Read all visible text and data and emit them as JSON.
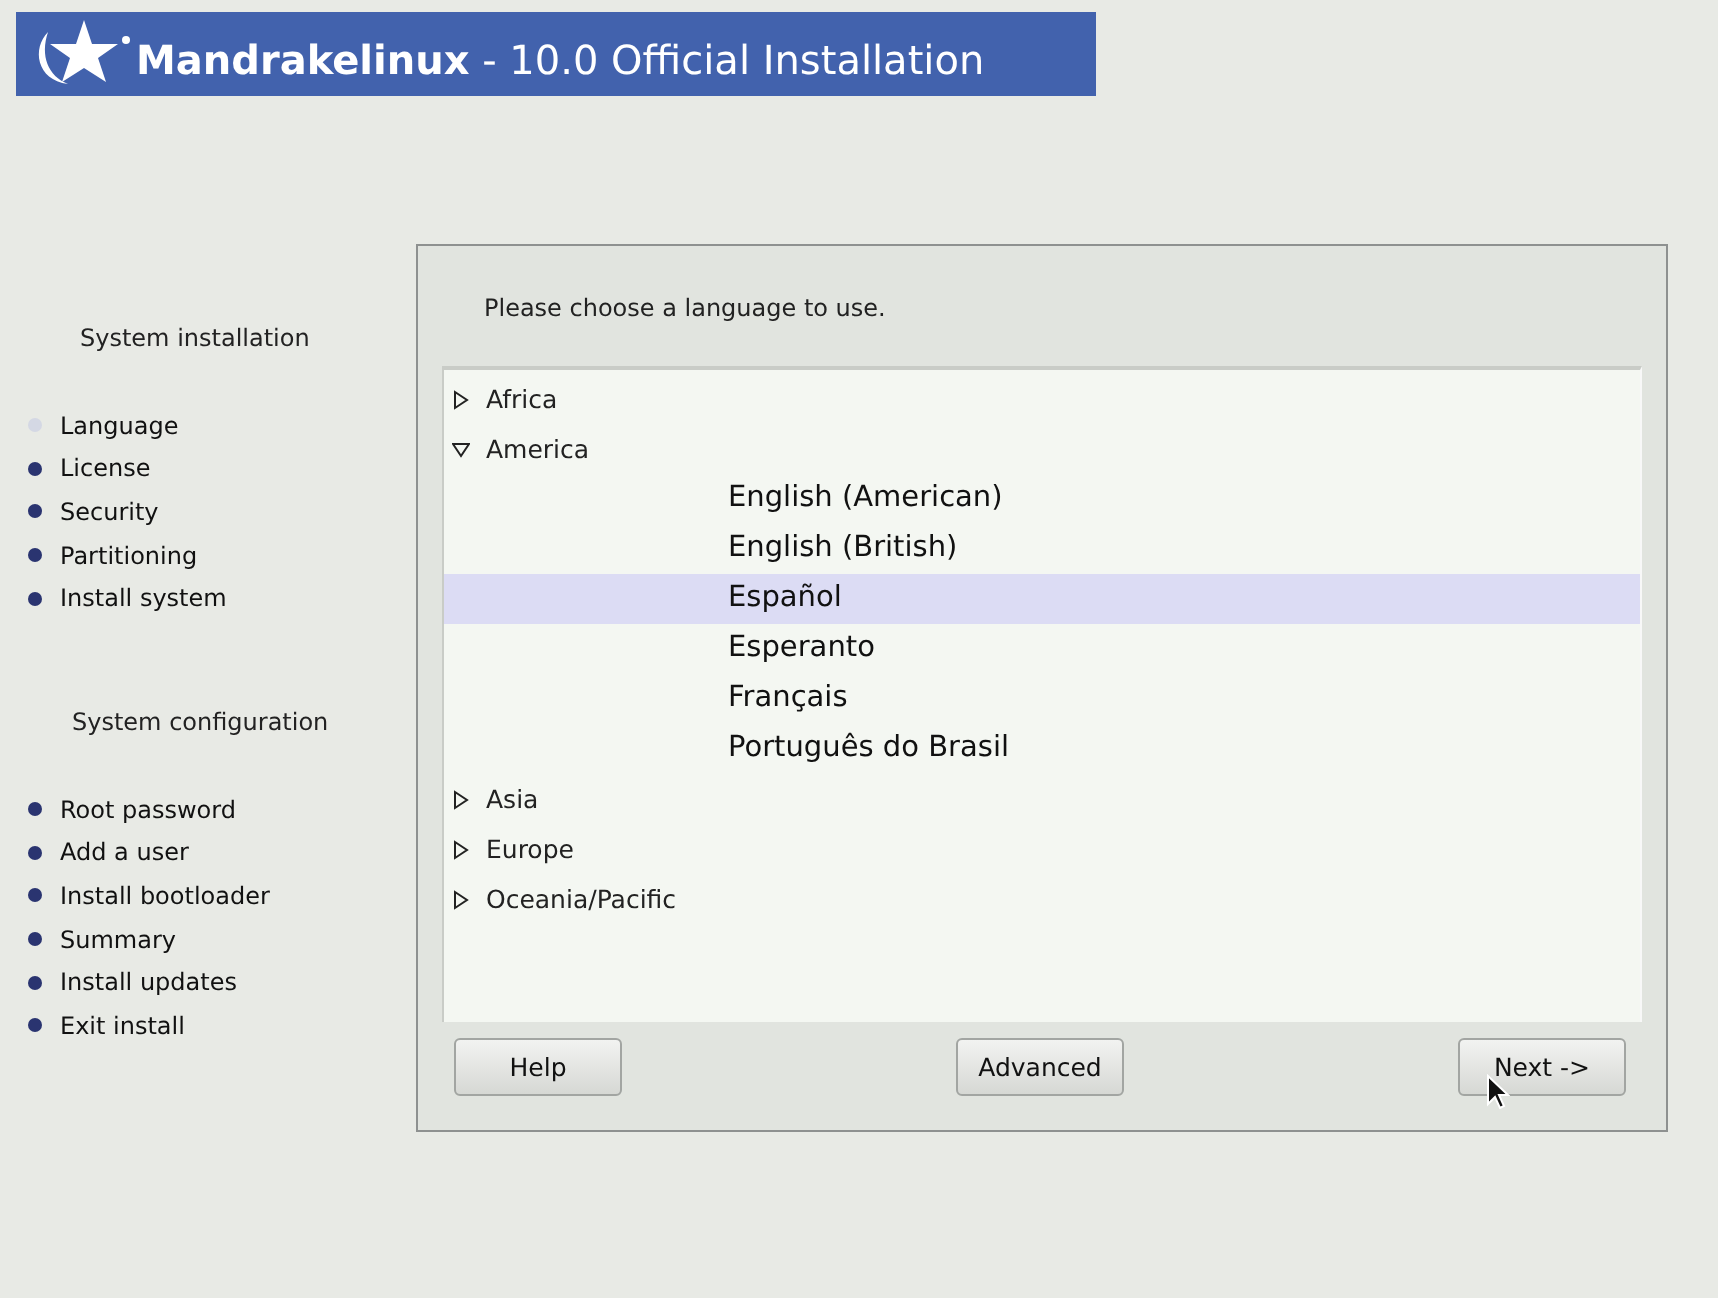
{
  "banner": {
    "title": "**Mandrakelinux** - 10.0 Official Installation"
  },
  "sidebar": {
    "sections": [
      {
        "heading": "System installation",
        "steps": [
          {
            "label": "Language",
            "selected": true
          },
          {
            "label": "License",
            "selected": false
          },
          {
            "label": "Security",
            "selected": false
          },
          {
            "label": "Partitioning",
            "selected": false
          },
          {
            "label": "Install system",
            "selected": false
          }
        ]
      },
      {
        "heading": "System configuration",
        "steps": [
          {
            "label": "Root password",
            "selected": false
          },
          {
            "label": "Add a user",
            "selected": false
          },
          {
            "label": "Install bootloader",
            "selected": false
          },
          {
            "label": "Summary",
            "selected": false
          },
          {
            "label": "Install updates",
            "selected": false
          },
          {
            "label": "Exit install",
            "selected": false
          }
        ]
      }
    ]
  },
  "prompt": "Please choose a language to use.",
  "tree": [
    {
      "label": "Africa",
      "expanded": false
    },
    {
      "label": "America",
      "expanded": true,
      "children": [
        {
          "label": "English (American)",
          "selected": false
        },
        {
          "label": "English (British)",
          "selected": false
        },
        {
          "label": "Español",
          "selected": true
        },
        {
          "label": "Esperanto",
          "selected": false
        },
        {
          "label": "Français",
          "selected": false
        },
        {
          "label": "Português do Brasil",
          "selected": false
        }
      ]
    },
    {
      "label": "Asia",
      "expanded": false
    },
    {
      "label": "Europe",
      "expanded": false
    },
    {
      "label": "Oceania/Pacific",
      "expanded": false
    }
  ],
  "buttons": [
    "Help",
    "Advanced",
    "Next ->"
  ]
}
